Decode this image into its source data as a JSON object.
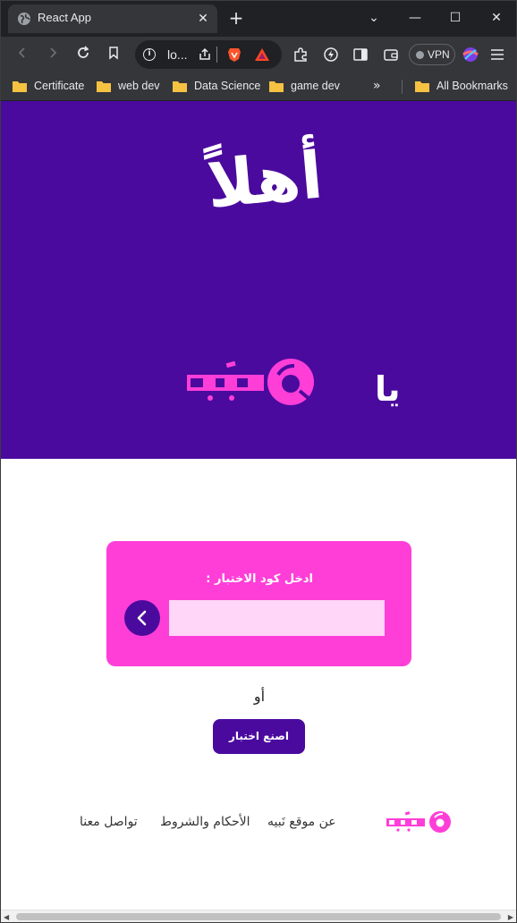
{
  "browser": {
    "tab_title": "React App",
    "tab_close": "✕",
    "new_tab": "+",
    "url": "lo...",
    "vpn_label": "VPN",
    "window_controls": {
      "chevron": "⌄",
      "minimize": "—",
      "maximize": "☐",
      "close": "✕"
    },
    "bookmarks": [
      {
        "label": "Certificate"
      },
      {
        "label": "web dev"
      },
      {
        "label": "Data Science"
      },
      {
        "label": "game dev"
      }
    ],
    "bookmarks_more": "»",
    "all_bookmarks": "All Bookmarks"
  },
  "hero": {
    "welcome": "أهلاً",
    "ya": "يا",
    "logo_text": "نَبيه",
    "bg_color": "#4b0a9e",
    "logo_color": "#ff3ed8"
  },
  "quiz": {
    "label": "ادخل كود الاختبار :",
    "input_value": "",
    "input_placeholder": "",
    "or_text": "أو",
    "create_button": "اصنع اختبار"
  },
  "footer": {
    "logo_text": "نَبيه",
    "links": [
      {
        "label": "عن موقع نَبيه"
      },
      {
        "label": "الأحكام والشروط"
      },
      {
        "label": "تواصل معنا"
      }
    ]
  }
}
